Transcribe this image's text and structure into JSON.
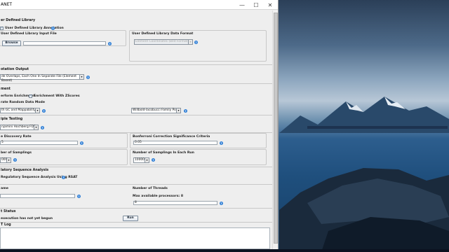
{
  "window": {
    "title": "ANET",
    "minimize_glyph": "—",
    "maximize_glyph": "☐",
    "close_glyph": "✕"
  },
  "user_library": {
    "section": "er Defined Library",
    "annotation_checkbox_label": "User Defined Library Annotation",
    "input_file_label": "User Defined Library Input File",
    "browse_label": "Browse",
    "input_file_value": "",
    "data_format_label": "User Defined Library Data Format",
    "data_format_value": "Element Coordinates (Bed Format)"
  },
  "annotation_output": {
    "section": "otation Output",
    "mode_value": "de Overlaps, Each One In Separate File (Element Based)"
  },
  "enrichment": {
    "section": "ment",
    "option_left_label": "erform Enrichment",
    "option_right_label": "Enrichment With ZScores",
    "random_mode_label": "rate Random Data Mode",
    "random_mode_value": "th GC and Mappability",
    "correction_value": "Willbold-Iacobucci Family Pools"
  },
  "multiple_testing": {
    "section": "iple Testing",
    "method_value": "njamini Hochberg FDR"
  },
  "fdr": {
    "label": "e Discovery Rate",
    "value": "5",
    "bonferroni_label": "Bonferroni Correction Significance Criteria",
    "bonferroni_value": "0.05"
  },
  "samplings": {
    "label": "ber of Samplings",
    "value": "000",
    "each_run_label": "Number of Samplings In Each Run",
    "each_run_value": "10000"
  },
  "regulatory": {
    "section": "latory Sequence Analysis",
    "checkbox_label": "Regulatory Sequence Analysis Using RSAT"
  },
  "job": {
    "name_label": "ame",
    "name_value": "",
    "threads_label": "Number of Threads",
    "max_processors_label": "Max available processors: 8",
    "threads_value": "8"
  },
  "status": {
    "section": "t Status",
    "text": "execution has not yet begun"
  },
  "run_label": "Run",
  "log": {
    "section": "T Log"
  },
  "colors": {
    "help_icon": "#2f7fd6",
    "window_bg": "#eeeeee"
  }
}
